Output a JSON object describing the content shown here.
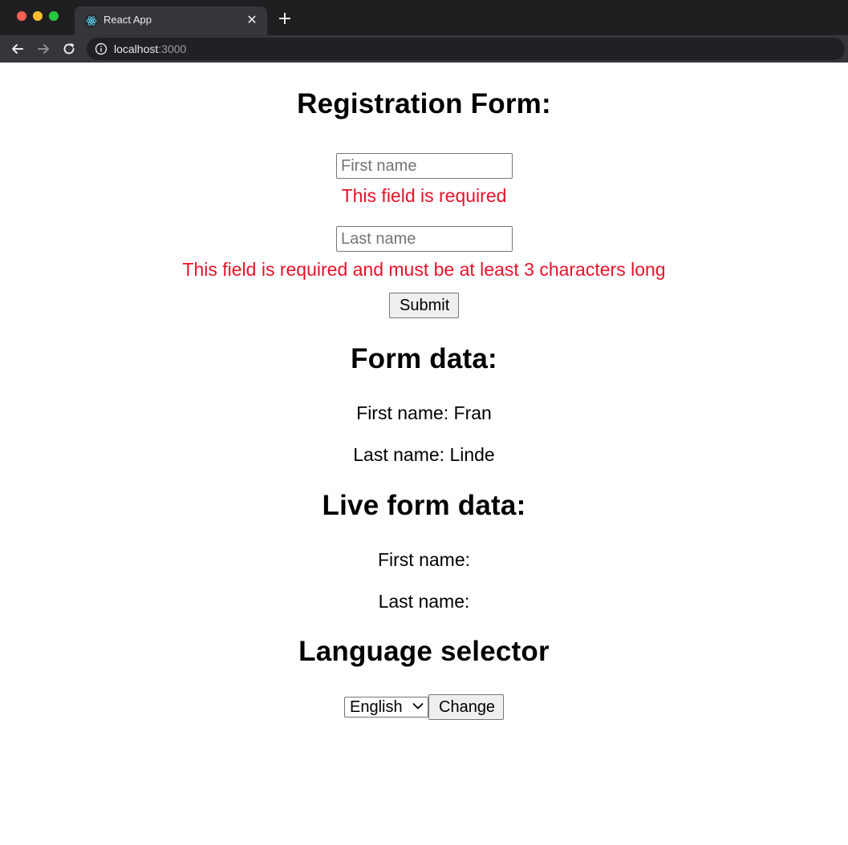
{
  "browser": {
    "tab_title": "React App",
    "tab_close_icon": "close-icon",
    "new_tab_icon": "plus-icon",
    "url_host": "localhost",
    "url_port": ":3000",
    "colors": {
      "chrome_bg": "#202124",
      "tab_bg": "#35363a",
      "accent_react": "#61dafb"
    }
  },
  "registration": {
    "title": "Registration Form:",
    "first_name_placeholder": "First name",
    "first_name_value": "",
    "first_name_error": "This field is required",
    "last_name_placeholder": "Last name",
    "last_name_value": "",
    "last_name_error": "This field is required and must be at least 3 characters long",
    "submit_label": "Submit",
    "error_color": "#e8122a"
  },
  "form_data": {
    "title": "Form data:",
    "first_name_line": "First name: Fran",
    "last_name_line": "Last name: Linde"
  },
  "live_form_data": {
    "title": "Live form data:",
    "first_name_line": "First name:",
    "last_name_line": "Last name:"
  },
  "language": {
    "title": "Language selector",
    "selected": "English",
    "change_label": "Change"
  }
}
